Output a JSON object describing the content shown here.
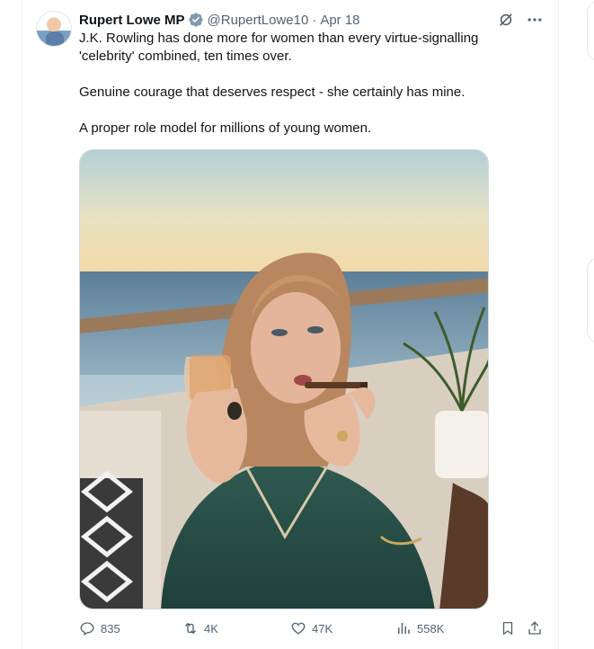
{
  "tweet": {
    "author_name": "Rupert Lowe MP",
    "handle": "@RupertLowe10",
    "separator": "·",
    "date": "Apr 18",
    "paragraphs": [
      "J.K. Rowling has done more for women than every virtue-signalling 'celebrity' combined, ten times over.",
      "Genuine courage that deserves respect - she certainly has mine.",
      "A proper role model for millions of young women."
    ]
  },
  "icons": {
    "verified": "verified-badge-icon",
    "grok": "grok-icon",
    "more": "more-icon",
    "reply": "reply-icon",
    "retweet": "retweet-icon",
    "like": "like-icon",
    "views": "views-icon",
    "bookmark": "bookmark-icon",
    "share": "share-icon"
  },
  "metrics": {
    "replies": "835",
    "retweets": "4K",
    "likes": "47K",
    "views": "558K"
  },
  "colors": {
    "text_primary": "#0f1419",
    "text_secondary": "#536471",
    "verified_badge": "#829aab",
    "border": "#eff3f4"
  }
}
